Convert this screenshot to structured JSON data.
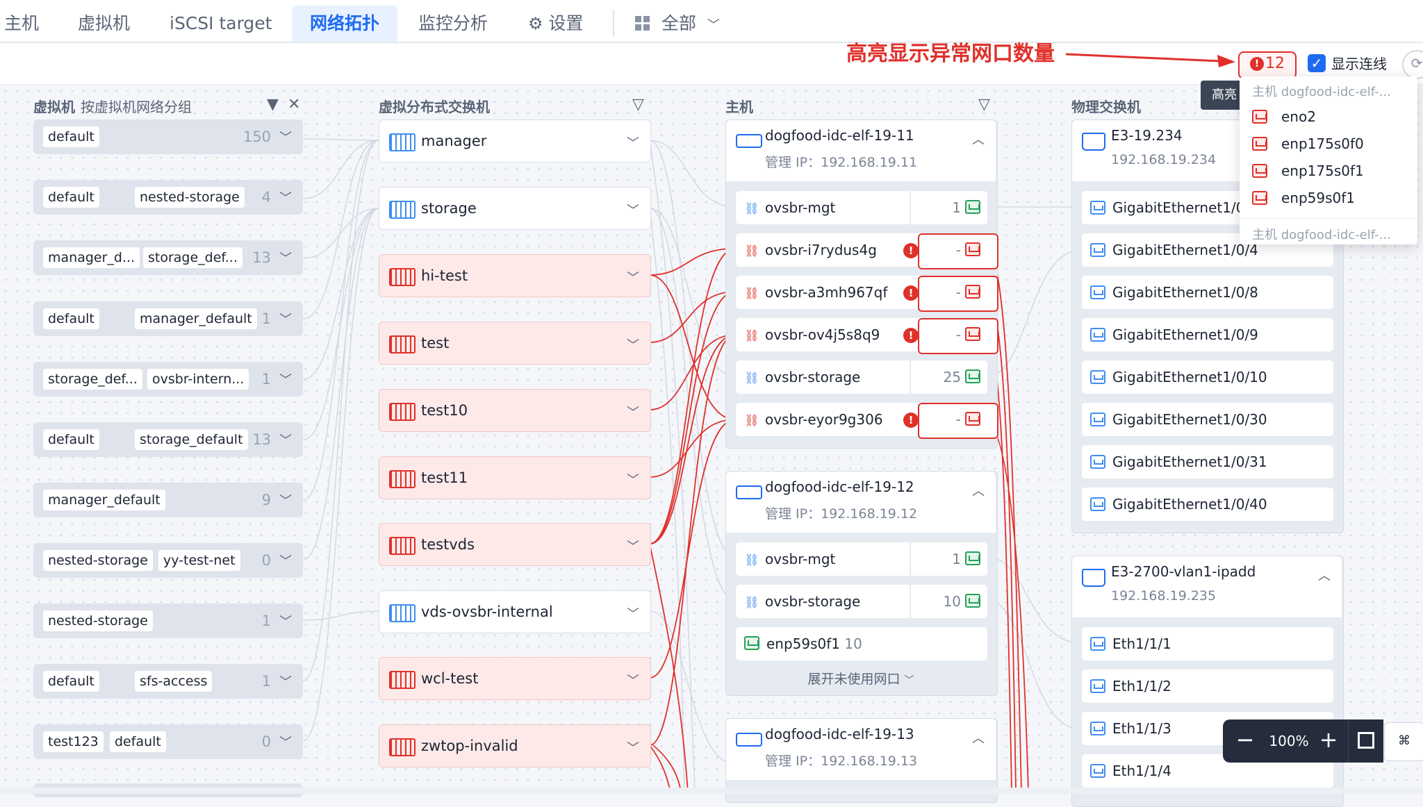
{
  "tabs": [
    {
      "label": "主机"
    },
    {
      "label": "虚拟机"
    },
    {
      "label": "iSCSI target"
    },
    {
      "label": "网络拓扑"
    },
    {
      "label": "监控分析"
    },
    {
      "label": "设置"
    },
    {
      "label": "全部"
    }
  ],
  "active_tab": "网络拓扑",
  "toolbar": {
    "annotation": "高亮显示异常网口数量",
    "error_count": "12",
    "show_links_label": "显示连线",
    "show_links_checked": true
  },
  "columns": {
    "vm": {
      "title": "虚拟机",
      "subtitle": "按虚拟机网络分组"
    },
    "vds": {
      "title": "虚拟分布式交换机"
    },
    "host": {
      "title": "主机"
    },
    "switch": {
      "title": "物理交换机"
    }
  },
  "vm_groups": [
    {
      "tags": [
        "default"
      ],
      "count": "150"
    },
    {
      "tags": [
        "default",
        "nested-storage"
      ],
      "count": "4"
    },
    {
      "tags": [
        "manager_d...",
        "storage_def..."
      ],
      "count": "13"
    },
    {
      "tags": [
        "default",
        "manager_default"
      ],
      "count": "1"
    },
    {
      "tags": [
        "storage_def...",
        "ovsbr-intern..."
      ],
      "count": "1"
    },
    {
      "tags": [
        "default",
        "storage_default"
      ],
      "count": "13"
    },
    {
      "tags": [
        "manager_default"
      ],
      "count": "9"
    },
    {
      "tags": [
        "nested-storage",
        "yy-test-net"
      ],
      "count": "0"
    },
    {
      "tags": [
        "nested-storage"
      ],
      "count": "1"
    },
    {
      "tags": [
        "default",
        "sfs-access"
      ],
      "count": "1"
    },
    {
      "tags": [
        "test123",
        "default"
      ],
      "count": "0"
    }
  ],
  "vds_list": [
    {
      "name": "manager",
      "alert": false
    },
    {
      "name": "storage",
      "alert": false
    },
    {
      "name": "hi-test",
      "alert": true
    },
    {
      "name": "test",
      "alert": true
    },
    {
      "name": "test10",
      "alert": true
    },
    {
      "name": "test11",
      "alert": true
    },
    {
      "name": "testvds",
      "alert": true
    },
    {
      "name": "vds-ovsbr-internal",
      "alert": false
    },
    {
      "name": "wcl-test",
      "alert": true
    },
    {
      "name": "zwtop-invalid",
      "alert": true
    }
  ],
  "hosts": [
    {
      "name": "dogfood-idc-elf-19-11",
      "ip_label": "管理 IP：",
      "ip": "192.168.19.11",
      "bridges": [
        {
          "name": "ovsbr-mgt",
          "count": "1",
          "alert": false
        },
        {
          "name": "ovsbr-i7rydus4g",
          "count": "-",
          "alert": true
        },
        {
          "name": "ovsbr-a3mh967qf",
          "count": "-",
          "alert": true
        },
        {
          "name": "ovsbr-ov4j5s8q9",
          "count": "-",
          "alert": true
        },
        {
          "name": "ovsbr-storage",
          "count": "25",
          "alert": false
        },
        {
          "name": "ovsbr-eyor9g306",
          "count": "-",
          "alert": true
        }
      ]
    },
    {
      "name": "dogfood-idc-elf-19-12",
      "ip_label": "管理 IP：",
      "ip": "192.168.19.12",
      "bridges": [
        {
          "name": "ovsbr-mgt",
          "count": "1",
          "alert": false
        },
        {
          "name": "ovsbr-storage",
          "count": "10",
          "alert": false
        }
      ],
      "free_nic": {
        "name": "enp59s0f1",
        "count": "10"
      },
      "expand_label": "展开未使用网口"
    },
    {
      "name": "dogfood-idc-elf-19-13",
      "ip_label": "管理 IP：",
      "ip": "192.168.19.13"
    }
  ],
  "switches": [
    {
      "name": "E3-19.234",
      "ip": "192.168.19.234",
      "ports": [
        "GigabitEthernet1/0/1",
        "GigabitEthernet1/0/4",
        "GigabitEthernet1/0/8",
        "GigabitEthernet1/0/9",
        "GigabitEthernet1/0/10",
        "GigabitEthernet1/0/30",
        "GigabitEthernet1/0/31",
        "GigabitEthernet1/0/40"
      ]
    },
    {
      "name": "E3-2700-vlan1-ipadd",
      "ip": "192.168.19.235",
      "ports": [
        "Eth1/1/1",
        "Eth1/1/2",
        "Eth1/1/3",
        "Eth1/1/4"
      ]
    }
  ],
  "popup": {
    "tooltip": "高亮",
    "group1": "主机 dogfood-idc-elf-...",
    "items": [
      "eno2",
      "enp175s0f0",
      "enp175s0f1",
      "enp59s0f1"
    ],
    "group2": "主机 dogfood-idc-elf-..."
  },
  "zoom": {
    "value": "100%",
    "minus": "−",
    "plus": "+",
    "shortcut": "⌘"
  },
  "colors": {
    "accent": "#1e6bf2",
    "alert": "#e0302a",
    "ok": "#23a05a"
  },
  "icons": {
    "settings": "gear-icon",
    "all": "grid-icon",
    "filter": "filter-icon",
    "close": "close-icon"
  }
}
